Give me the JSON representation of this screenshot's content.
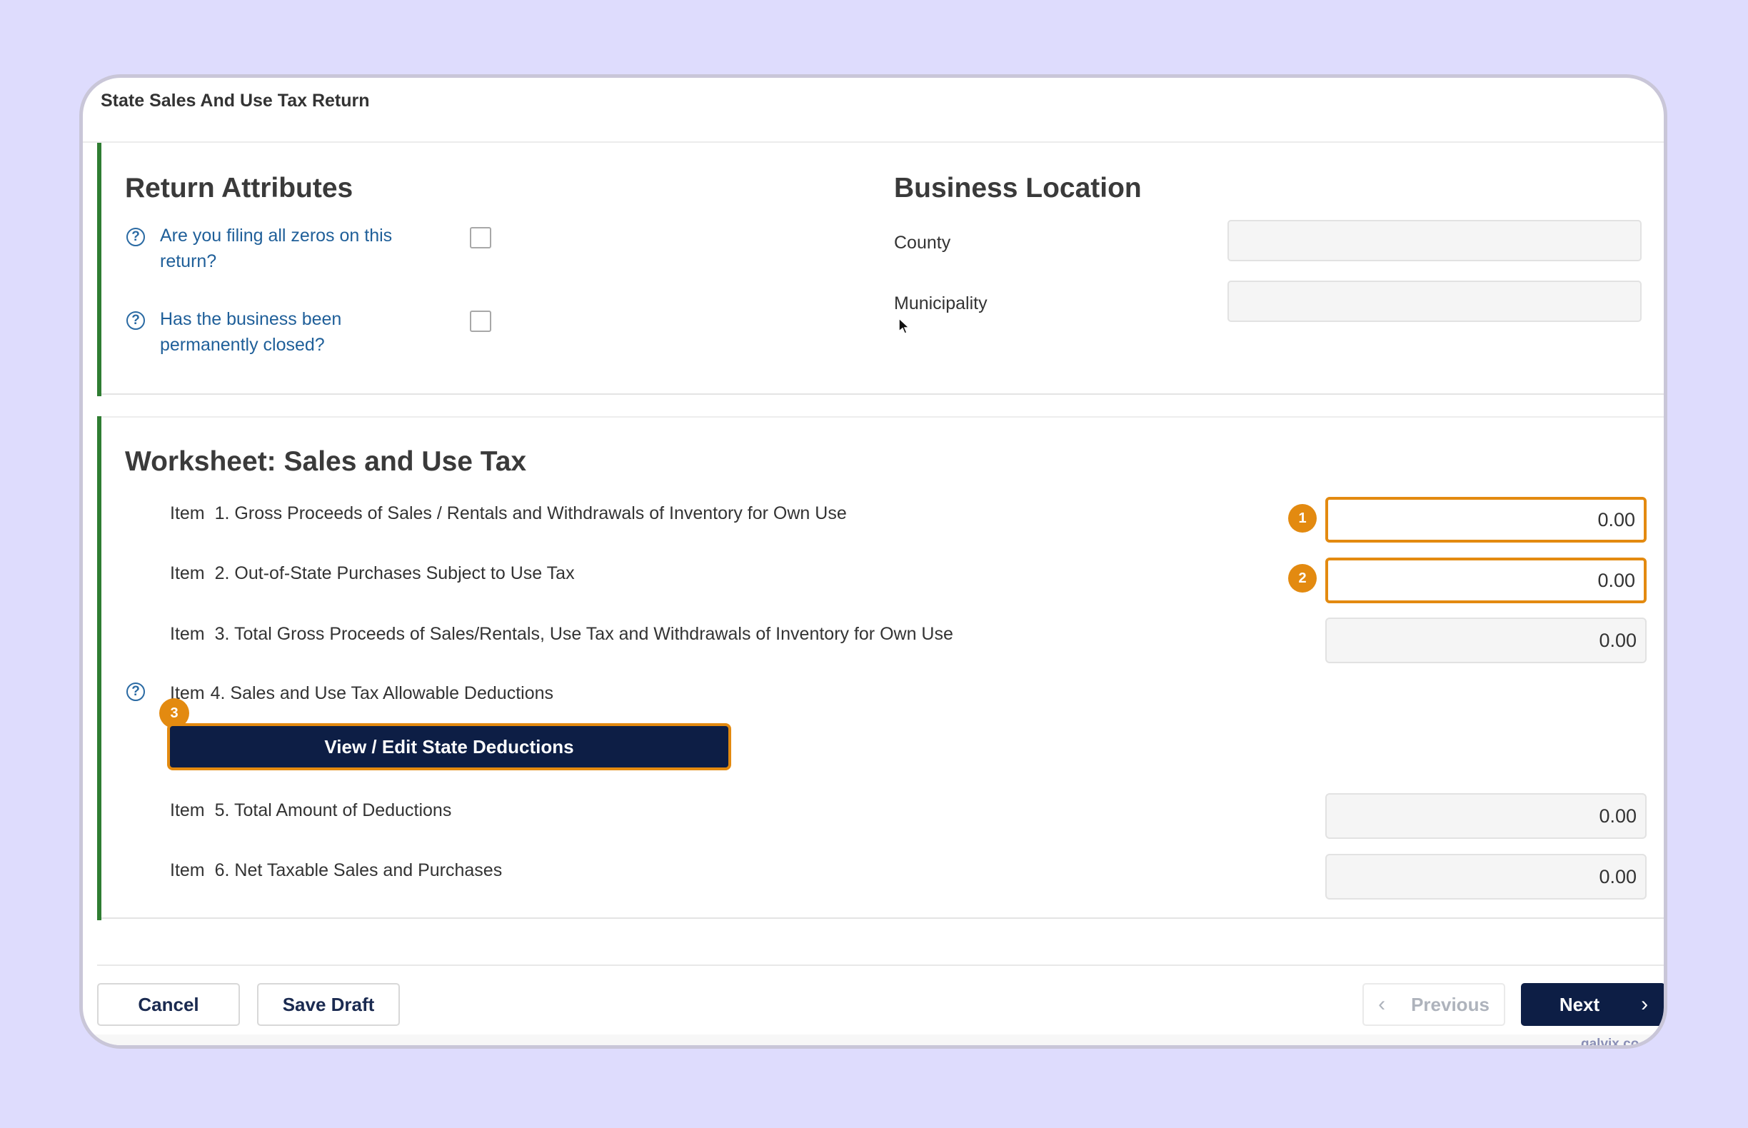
{
  "window": {
    "title": "State Sales And Use Tax Return"
  },
  "return_attributes": {
    "title": "Return Attributes",
    "questions": [
      {
        "text": "Are you filing all zeros on this return?",
        "checked": false
      },
      {
        "text": "Has the business been permanently closed?",
        "checked": false
      }
    ]
  },
  "business_location": {
    "title": "Business Location",
    "county_label": "County",
    "county_value": "",
    "municipality_label": "Municipality",
    "municipality_value": ""
  },
  "worksheet": {
    "title": "Worksheet: Sales and Use Tax",
    "item_word": "Item",
    "items": [
      {
        "label": "1. Gross Proceeds of Sales / Rentals and Withdrawals of Inventory for Own Use",
        "value": "0.00",
        "badge": "1"
      },
      {
        "label": "2. Out-of-State Purchases Subject to Use Tax",
        "value": "0.00",
        "badge": "2"
      },
      {
        "label": "3. Total Gross Proceeds of Sales/Rentals, Use Tax and Withdrawals of Inventory for Own Use",
        "value": "0.00"
      },
      {
        "label": "4. Sales and Use Tax Allowable Deductions",
        "badge": "3"
      },
      {
        "label": "5. Total Amount of Deductions",
        "value": "0.00"
      },
      {
        "label": "6. Net Taxable Sales and Purchases",
        "value": "0.00"
      }
    ],
    "deductions_button": "View / Edit State Deductions"
  },
  "footer": {
    "cancel": "Cancel",
    "save_draft": "Save Draft",
    "previous": "Previous",
    "next": "Next"
  },
  "watermark": "galvix.co",
  "icons": {
    "help": "question-circle-icon",
    "prev": "chevron-left-icon",
    "next": "chevron-right-icon",
    "cursor": "mouse-pointer-icon"
  },
  "colors": {
    "accent": "#e38a10",
    "primary": "#0d1e45",
    "section_bar": "#2f7d32",
    "link": "#1f5f99",
    "background": "#dedcfd"
  }
}
